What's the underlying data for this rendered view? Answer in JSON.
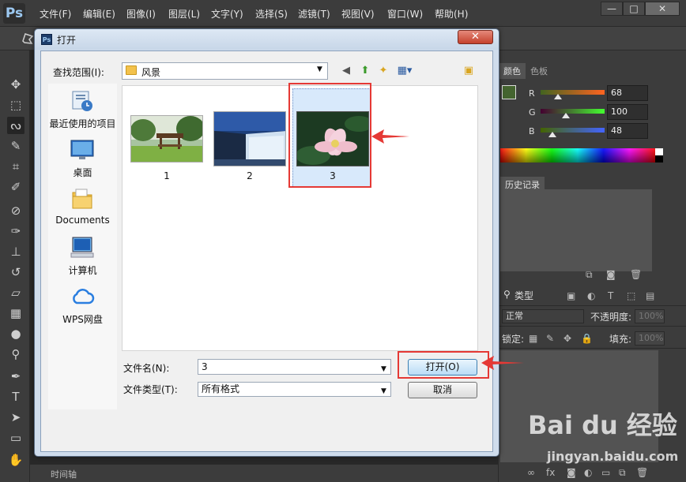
{
  "app": {
    "logo": "Ps",
    "menus": [
      "文件(F)",
      "编辑(E)",
      "图像(I)",
      "图层(L)",
      "文字(Y)",
      "选择(S)",
      "滤镜(T)",
      "视图(V)",
      "窗口(W)",
      "帮助(H)"
    ],
    "window_buttons": [
      "—",
      "□",
      "✕"
    ]
  },
  "dialog": {
    "title": "打开",
    "close_label": "✕",
    "lookin_label": "查找范围(I):",
    "lookin_value": "风景",
    "places": [
      {
        "label": "最近使用的项目",
        "icon": "recent-items-icon"
      },
      {
        "label": "桌面",
        "icon": "desktop-icon"
      },
      {
        "label": "Documents",
        "icon": "documents-folder-icon"
      },
      {
        "label": "计算机",
        "icon": "computer-icon"
      },
      {
        "label": "WPS网盘",
        "icon": "wps-cloud-icon"
      }
    ],
    "files": [
      {
        "label": "1",
        "thumb": "pavilion-landscape"
      },
      {
        "label": "2",
        "thumb": "waterfall-landscape"
      },
      {
        "label": "3",
        "thumb": "lotus-flower",
        "selected": true
      }
    ],
    "filename_label": "文件名(N):",
    "filename_value": "3",
    "filetype_label": "文件类型(T):",
    "filetype_value": "所有格式",
    "open_button": "打开(O)",
    "cancel_button": "取消"
  },
  "panels": {
    "color_tabs": [
      "颜色",
      "色板"
    ],
    "rgb": [
      {
        "channel": "R",
        "value": "68",
        "fraction": 0.27
      },
      {
        "channel": "G",
        "value": "100",
        "fraction": 0.39
      },
      {
        "channel": "B",
        "value": "48",
        "fraction": 0.19
      }
    ],
    "history_tab": "历史记录",
    "layers": {
      "filter_kind": "类型",
      "blend_mode": "正常",
      "opacity_label": "不透明度:",
      "opacity_value": "100%",
      "lock_label": "锁定:",
      "fill_label": "填充:",
      "fill_value": "100%"
    }
  },
  "timeline": {
    "label": "时间轴"
  },
  "watermark": {
    "brand": "Bai du 经验",
    "url": "jingyan.baidu.com"
  },
  "colors": {
    "foreground": "#44642f",
    "highlight": "#e53935",
    "dialog_chrome": "#cfdcec"
  }
}
